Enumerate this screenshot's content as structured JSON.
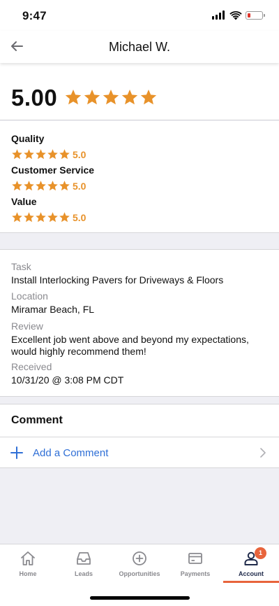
{
  "status": {
    "time": "9:47"
  },
  "header": {
    "title": "Michael W."
  },
  "overall": {
    "score": "5.00",
    "rating": 5,
    "max": 5
  },
  "ratings": [
    {
      "label": "Quality",
      "rating": 5,
      "value": "5.0"
    },
    {
      "label": "Customer Service",
      "rating": 5,
      "value": "5.0"
    },
    {
      "label": "Value",
      "rating": 5,
      "value": "5.0"
    }
  ],
  "details": {
    "task_label": "Task",
    "task": "Install Interlocking Pavers for Driveways & Floors",
    "location_label": "Location",
    "location": "Miramar Beach, FL",
    "review_label": "Review",
    "review": "Excellent job went above and beyond my expectations, would highly recommend them!",
    "received_label": "Received",
    "received": "10/31/20 @ 3:08 PM CDT"
  },
  "comment": {
    "heading": "Comment",
    "add_label": "Add a Comment"
  },
  "tabs": [
    {
      "label": "Home",
      "icon": "home-icon"
    },
    {
      "label": "Leads",
      "icon": "inbox-icon"
    },
    {
      "label": "Opportunities",
      "icon": "plus-circle-icon"
    },
    {
      "label": "Payments",
      "icon": "card-icon"
    },
    {
      "label": "Account",
      "icon": "person-icon",
      "badge": "1",
      "active": true
    }
  ],
  "colors": {
    "star": "#e8922a",
    "link": "#2f6fd6",
    "accent": "#e8643c",
    "active_tab": "#1f2a4a"
  }
}
